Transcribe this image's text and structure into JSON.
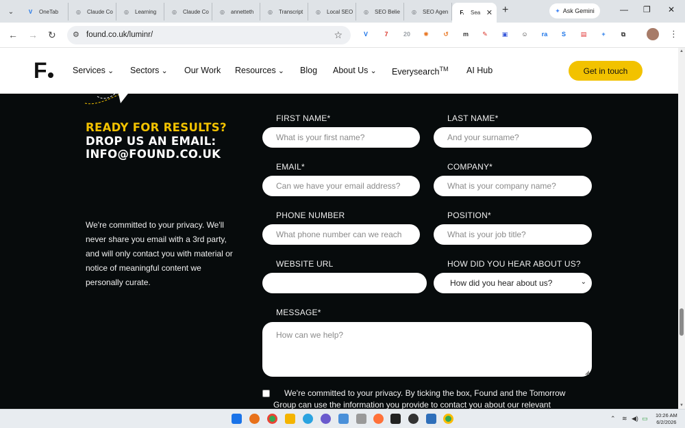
{
  "browser": {
    "tabs": [
      {
        "label": "OneTab",
        "color": "#1a73e8",
        "glyph": "V"
      },
      {
        "label": "Claude Co",
        "color": "#5f6368",
        "glyph": "◎"
      },
      {
        "label": "Learning",
        "color": "#5f6368",
        "glyph": "◎"
      },
      {
        "label": "Claude Co",
        "color": "#5f6368",
        "glyph": "◎"
      },
      {
        "label": "annetteth",
        "color": "#5f6368",
        "glyph": "◎"
      },
      {
        "label": "Transcript",
        "color": "#5f6368",
        "glyph": "◎"
      },
      {
        "label": "Local SEO",
        "color": "#5f6368",
        "glyph": "◎"
      },
      {
        "label": "SEO Belie",
        "color": "#5f6368",
        "glyph": "◎"
      },
      {
        "label": "SEO Agen",
        "color": "#5f6368",
        "glyph": "◎"
      },
      {
        "label": "Sea",
        "color": "#111111",
        "glyph": "F."
      }
    ],
    "ask_gemini": "Ask Gemini",
    "url": "found.co.uk/luminr/",
    "extensions": [
      {
        "name": "vimeo-icon",
        "glyph": "V",
        "color": "#1a73e8"
      },
      {
        "name": "badge-7-icon",
        "glyph": "7",
        "color": "#d93025"
      },
      {
        "name": "house-20-icon",
        "glyph": "20",
        "color": "#9aa0a6"
      },
      {
        "name": "sparkle-icon",
        "glyph": "✺",
        "color": "#e8711a"
      },
      {
        "name": "arrow-ext-icon",
        "glyph": "↺",
        "color": "#e8711a"
      },
      {
        "name": "m-ext-icon",
        "glyph": "m",
        "color": "#333333"
      },
      {
        "name": "pen-ext-icon",
        "glyph": "✎",
        "color": "#d93025"
      },
      {
        "name": "square-ext-icon",
        "glyph": "▣",
        "color": "#3b5bdb"
      },
      {
        "name": "smile-ext-icon",
        "glyph": "☺",
        "color": "#333333"
      },
      {
        "name": "ra-ext-icon",
        "glyph": "ra",
        "color": "#1a73e8"
      },
      {
        "name": "s-ext-icon",
        "glyph": "S",
        "color": "#1a73e8"
      },
      {
        "name": "red-ext-icon",
        "glyph": "▤",
        "color": "#e03131"
      },
      {
        "name": "plus-ext-icon",
        "glyph": "+",
        "color": "#1a73e8"
      },
      {
        "name": "puzzle-icon",
        "glyph": "⧉",
        "color": "#444444"
      }
    ]
  },
  "site": {
    "logo": "F",
    "nav": [
      {
        "label": "Services",
        "dropdown": true
      },
      {
        "label": "Sectors",
        "dropdown": true
      },
      {
        "label": "Our Work",
        "dropdown": false
      },
      {
        "label": "Resources",
        "dropdown": true
      },
      {
        "label": "Blog",
        "dropdown": false
      },
      {
        "label": "About Us",
        "dropdown": true
      },
      {
        "label": "Everysearch",
        "dropdown": false,
        "sup": "TM"
      },
      {
        "label": "AI Hub",
        "dropdown": false
      }
    ],
    "cta": "Get in touch"
  },
  "intro": {
    "headline_yellow": "READY FOR RESULTS?",
    "headline_white": "DROP US AN EMAIL: INFO@FOUND.CO.UK",
    "privacy": "We're committed to your privacy. We'll never share you email with a 3rd party, and will only contact you with material or notice of meaningful content we personally curate."
  },
  "form": {
    "first_name": {
      "label": "FIRST NAME*",
      "placeholder": "What is your first name?"
    },
    "last_name": {
      "label": "LAST NAME*",
      "placeholder": "And your surname?"
    },
    "email": {
      "label": "EMAIL*",
      "placeholder": "Can we have your email address?"
    },
    "company": {
      "label": "COMPANY*",
      "placeholder": "What is your company name?"
    },
    "phone": {
      "label": "PHONE NUMBER",
      "placeholder": "What phone number can we reach"
    },
    "position": {
      "label": "POSITION*",
      "placeholder": "What is your job title?"
    },
    "website": {
      "label": "WEBSITE URL",
      "placeholder": ""
    },
    "heard": {
      "label": "HOW DID YOU HEAR ABOUT US?",
      "selected": "How did you hear about us?"
    },
    "message": {
      "label": "MESSAGE*",
      "placeholder": "How can we help?"
    },
    "consent": "We're committed to your privacy. By ticking the box, Found and the Tomorrow Group can use the information you provide to contact you about our relevant"
  },
  "taskbar": {
    "time": "10:26 AM",
    "date": "6/2/2026"
  },
  "colors": {
    "accent": "#f2c200",
    "dark_bg": "#070b0c"
  }
}
